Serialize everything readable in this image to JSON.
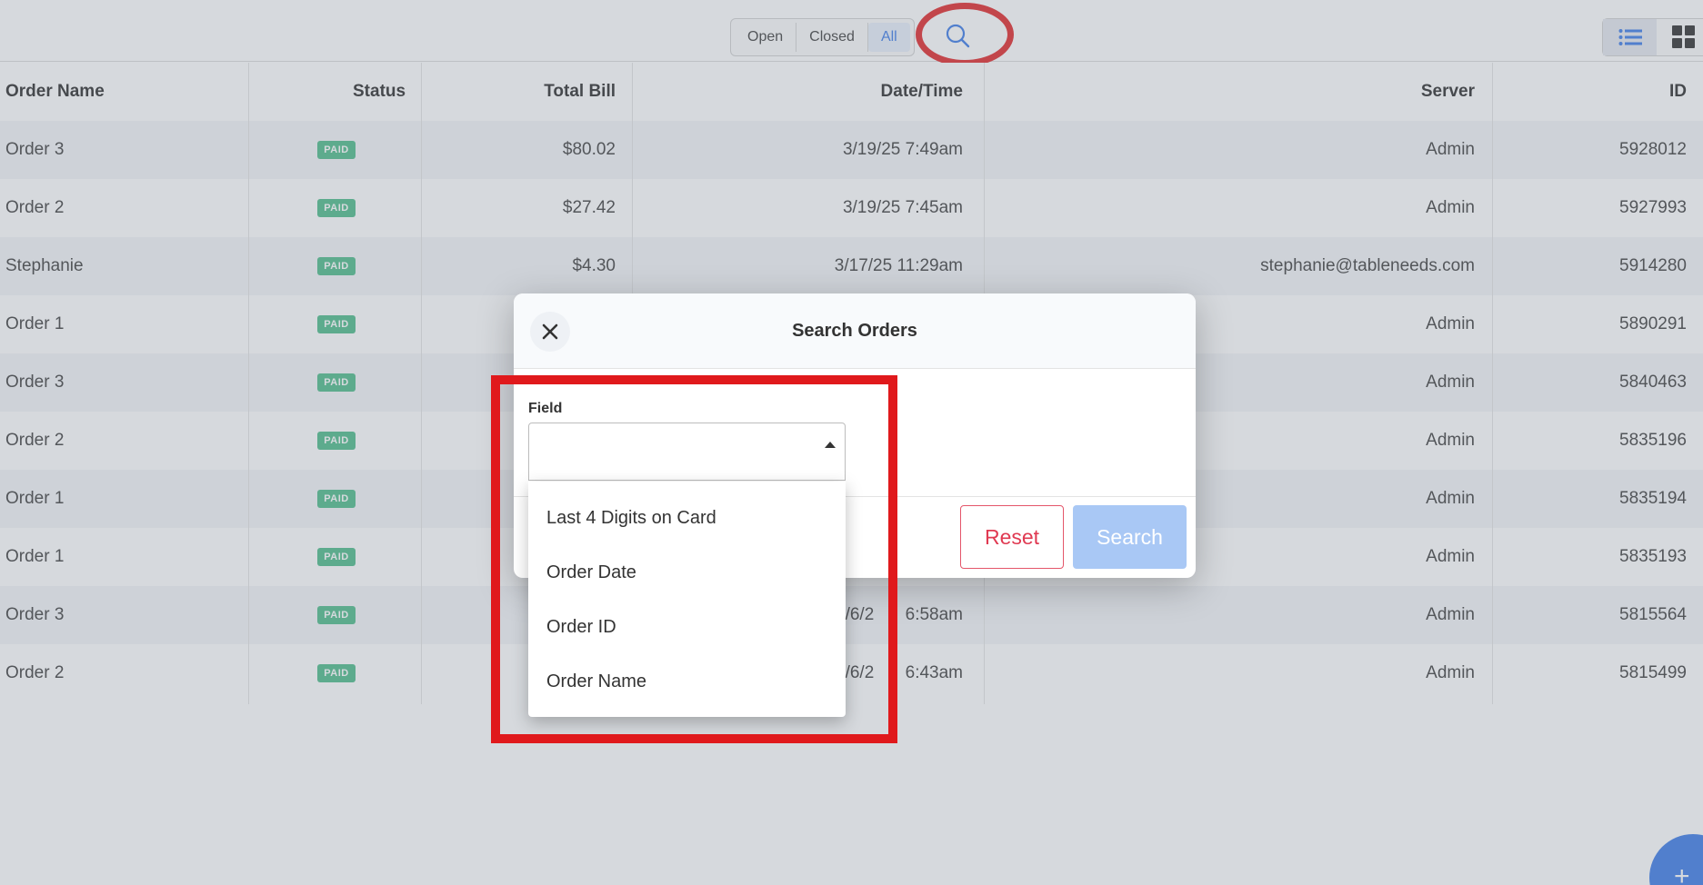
{
  "filters": {
    "open_label": "Open",
    "closed_label": "Closed",
    "all_label": "All"
  },
  "icons": {
    "search": "search-icon",
    "list_view": "list-view-icon",
    "grid_view": "grid-view-icon",
    "close": "close-icon",
    "add": "plus-icon"
  },
  "table": {
    "headers": {
      "name": "Order Name",
      "status": "Status",
      "bill": "Total Bill",
      "date": "Date/Time",
      "server": "Server",
      "id": "ID"
    },
    "rows": [
      {
        "name": "Order 3",
        "status": "PAID",
        "bill": "$80.02",
        "date": "3/19/25 7:49am",
        "server": "Admin",
        "id": "5928012"
      },
      {
        "name": "Order 2",
        "status": "PAID",
        "bill": "$27.42",
        "date": "3/19/25 7:45am",
        "server": "Admin",
        "id": "5927993"
      },
      {
        "name": "Stephanie",
        "status": "PAID",
        "bill": "$4.30",
        "date": "3/17/25 11:29am",
        "server": "stephanie@tableneeds.com",
        "id": "5914280"
      },
      {
        "name": "Order 1",
        "status": "PAID",
        "bill": "",
        "date": "",
        "server": "Admin",
        "id": "5890291"
      },
      {
        "name": "Order 3",
        "status": "PAID",
        "bill": "",
        "date": "",
        "server": "Admin",
        "id": "5840463"
      },
      {
        "name": "Order 2",
        "status": "PAID",
        "bill": "",
        "date": "",
        "server": "Admin",
        "id": "5835196"
      },
      {
        "name": "Order 1",
        "status": "PAID",
        "bill": "",
        "date": "",
        "server": "Admin",
        "id": "5835194"
      },
      {
        "name": "Order 1",
        "status": "PAID",
        "bill": "",
        "date": "",
        "server": "Admin",
        "id": "5835193"
      },
      {
        "name": "Order 3",
        "status": "PAID",
        "bill": "",
        "date": "3/6/2",
        "date_tail": "6:58am",
        "server": "Admin",
        "id": "5815564"
      },
      {
        "name": "Order 2",
        "status": "PAID",
        "bill": "",
        "date": "3/6/2",
        "date_tail": "6:43am",
        "server": "Admin",
        "id": "5815499"
      }
    ]
  },
  "modal": {
    "title": "Search Orders",
    "field_label": "Field",
    "field_value": "",
    "options": [
      "Last 4 Digits on Card",
      "Order Date",
      "Order ID",
      "Order Name"
    ],
    "reset_label": "Reset",
    "search_label": "Search"
  },
  "colors": {
    "accent": "#2f73e6",
    "paid_badge": "#42b883",
    "highlight": "#e0191c",
    "reset": "#e03a52",
    "search_disabled": "#a9c8f5"
  }
}
